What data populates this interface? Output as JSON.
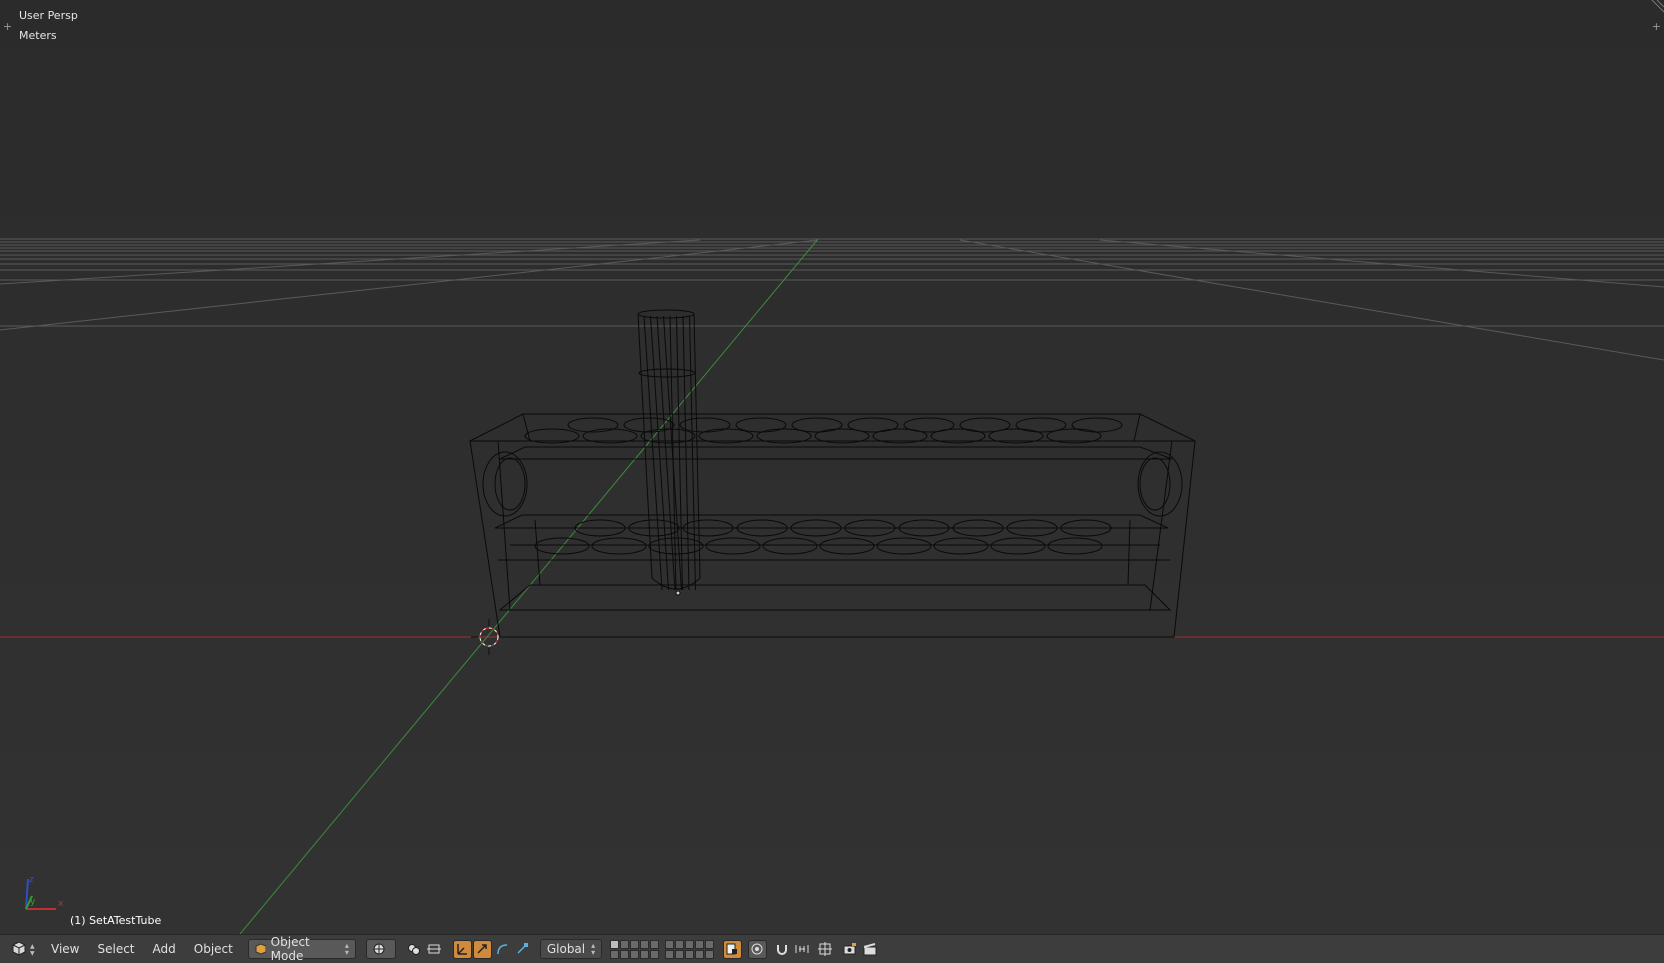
{
  "viewport": {
    "view_name": "User Persp",
    "units": "Meters",
    "active_object": "(1) SetATestTube",
    "axis_labels": {
      "z": "z",
      "y": "y",
      "x": "x"
    }
  },
  "header": {
    "menus": [
      "View",
      "Select",
      "Add",
      "Object"
    ],
    "mode": "Object Mode",
    "orientation": "Global"
  },
  "colors": {
    "x_axis": "#a03030",
    "y_axis": "#3c8c3c",
    "grid": "#5a5a5a",
    "wire": "#0a0a0a",
    "active_button": "#d08a3c"
  }
}
